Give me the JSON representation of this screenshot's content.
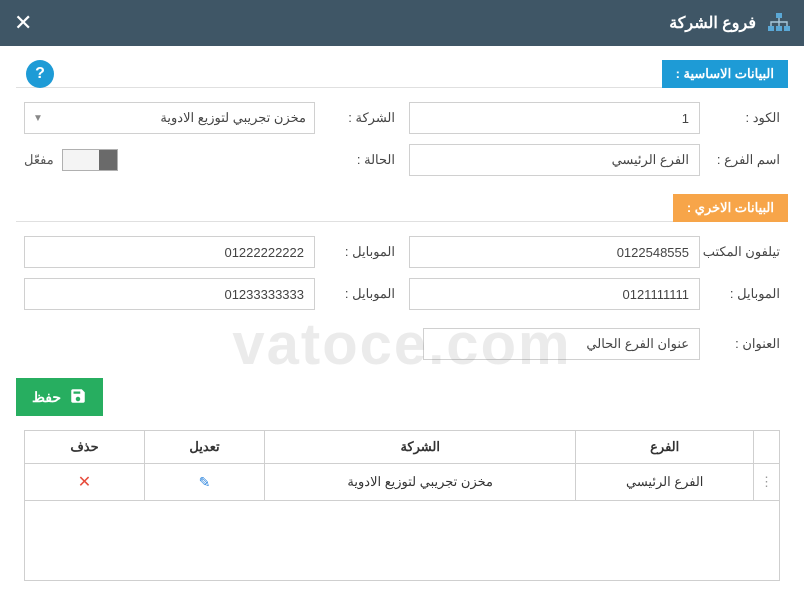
{
  "window": {
    "title": "فروع الشركة"
  },
  "sections": {
    "basic": "البيانات الاساسية :",
    "other": "البيانات الاخري :"
  },
  "labels": {
    "code": "الكود :",
    "company": "الشركة :",
    "branch_name": "اسم الفرع :",
    "status": "الحالة :",
    "office_phone": "تيلفون المكتب :",
    "mobile": "الموبايل :",
    "mobile2": "الموبايل :",
    "mobile3": "الموبايل :",
    "address": "العنوان :",
    "active": "مفعّل"
  },
  "values": {
    "code": "1",
    "company": "مخزن تجريبي لتوزيع الادوية",
    "branch_name": "الفرع الرئيسي",
    "office_phone": "0122548555",
    "mobile_a": "01222222222",
    "mobile_b": "0121111111",
    "mobile_c": "01233333333",
    "address": "عنوان الفرع الحالي"
  },
  "buttons": {
    "save": "حفظ"
  },
  "table": {
    "headers": {
      "branch": "الفرع",
      "company": "الشركة",
      "edit": "تعديل",
      "delete": "حذف"
    },
    "rows": [
      {
        "branch": "الفرع الرئيسي",
        "company": "مخزن تجريبي لتوزيع الادوية"
      }
    ]
  },
  "watermark": "vatoce.com"
}
